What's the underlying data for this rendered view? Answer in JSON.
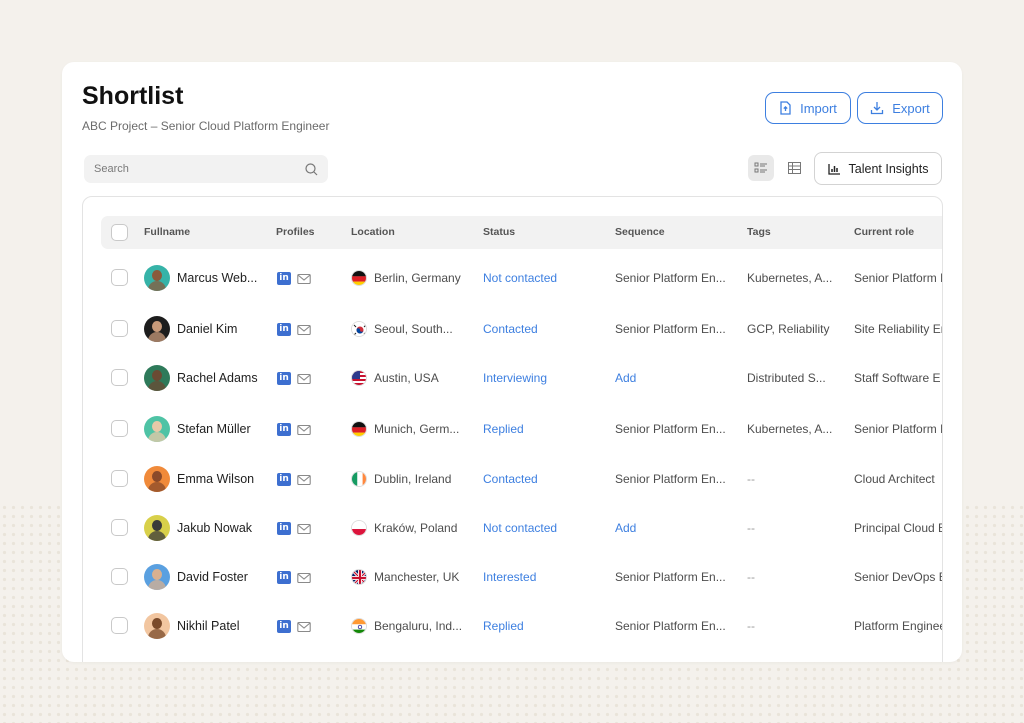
{
  "header": {
    "title": "Shortlist",
    "subtitle": "ABC Project – Senior Cloud Platform Engineer"
  },
  "toolbar": {
    "import_label": "Import",
    "export_label": "Export",
    "insights_label": "Talent Insights",
    "accent_color": "#3d7fe0"
  },
  "search": {
    "placeholder": "Search"
  },
  "columns": [
    "Fullname",
    "Profiles",
    "Location",
    "Status",
    "Sequence",
    "Tags",
    "Current role"
  ],
  "rows": [
    {
      "name": "Marcus Web...",
      "location": "Berlin, Germany",
      "flag": "de",
      "status": "Not contacted",
      "sequence": "Senior Platform En...",
      "tags": "Kubernetes, A...",
      "role": "Senior Platform I",
      "avatar": [
        "#36b3a8",
        "#8a5a3c"
      ]
    },
    {
      "name": "Daniel Kim",
      "location": "Seoul, South...",
      "flag": "kr",
      "status": "Contacted",
      "sequence": "Senior Platform En...",
      "tags": "GCP, Reliability",
      "role": "Site Reliability Er",
      "avatar": [
        "#1d1d1d",
        "#c89a7a"
      ]
    },
    {
      "name": "Rachel Adams",
      "location": "Austin, USA",
      "flag": "us",
      "status": "Interviewing",
      "sequence": "Add",
      "tags": "Distributed S...",
      "role": "Staff Software E",
      "avatar": [
        "#2e7a5a",
        "#6b4a33"
      ]
    },
    {
      "name": "Stefan Müller",
      "location": "Munich, Germ...",
      "flag": "de",
      "status": "Replied",
      "sequence": "Senior Platform En...",
      "tags": "Kubernetes, A...",
      "role": "Senior Platform I",
      "avatar": [
        "#4fc3a5",
        "#e8c9a8"
      ]
    },
    {
      "name": "Emma Wilson",
      "location": "Dublin, Ireland",
      "flag": "ie",
      "status": "Contacted",
      "sequence": "Senior Platform En...",
      "tags": "--",
      "role": "Cloud Architect",
      "avatar": [
        "#f08a3a",
        "#8a4a2a"
      ]
    },
    {
      "name": "Jakub Nowak",
      "location": "Kraków, Poland",
      "flag": "pl",
      "status": "Not contacted",
      "sequence": "Add",
      "tags": "--",
      "role": "Principal Cloud E",
      "avatar": [
        "#d8d04a",
        "#3a3a3a"
      ]
    },
    {
      "name": "David Foster",
      "location": "Manchester, UK",
      "flag": "gb",
      "status": "Interested",
      "sequence": "Senior Platform En...",
      "tags": "--",
      "role": "Senior DevOps E",
      "avatar": [
        "#5aa0e0",
        "#d8b090"
      ]
    },
    {
      "name": "Nikhil Patel",
      "location": "Bengaluru, Ind...",
      "flag": "in",
      "status": "Replied",
      "sequence": "Senior Platform En...",
      "tags": "--",
      "role": "Platform Enginee",
      "avatar": [
        "#f2c6a0",
        "#7a4a2a"
      ]
    }
  ]
}
